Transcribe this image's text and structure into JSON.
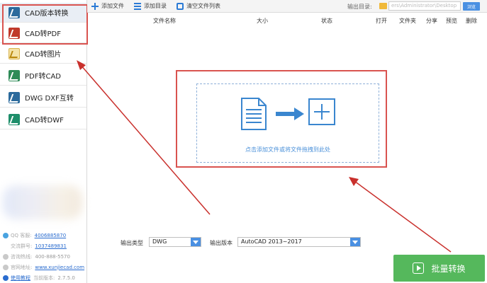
{
  "sidebar": {
    "items": [
      {
        "label": "CAD版本转换",
        "icon": "cad-file-icon"
      },
      {
        "label": "CAD转PDF",
        "icon": "pdf-file-icon"
      },
      {
        "label": "CAD转图片",
        "icon": "image-file-icon"
      },
      {
        "label": "PDF转CAD",
        "icon": "pdf-to-cad-icon"
      },
      {
        "label": "DWG DXF互转",
        "icon": "dwg-file-icon"
      },
      {
        "label": "CAD转DWF",
        "icon": "dwf-file-icon"
      }
    ],
    "info": {
      "qq_label": "QQ 客服:",
      "qq_value": "4006885870",
      "group_label": "交流群号:",
      "group_value": "1037489831",
      "phone_label": "咨询热线:",
      "phone_value": "400-888-5570",
      "site_label": "官网地址:",
      "site_value": "www.xunjiecad.com",
      "tutorial_label": "使用教程",
      "version_label": "当前版本:",
      "version_value": "2.7.5.0"
    }
  },
  "toolbar": {
    "add_file": "添加文件",
    "add_folder": "添加目录",
    "clear_list": "清空文件列表",
    "output_dir_label": "输出目录:",
    "output_dir_value": "ers\\Administrator\\Desktop",
    "browse": "浏览"
  },
  "columns": [
    "文件名称",
    "大小",
    "状态",
    "打开",
    "文件夹",
    "分享",
    "预览",
    "删除"
  ],
  "dropzone": {
    "hint": "点击添加文件或将文件拖拽到此处"
  },
  "options": {
    "output_type_label": "输出类型",
    "output_type_value": "DWG",
    "output_version_label": "输出版本",
    "output_version_value": "AutoCAD 2013~2017"
  },
  "convert_button": "批量转换",
  "colors": {
    "accent": "#4a90e2",
    "annotation_red": "#d9534f",
    "convert_green": "#55b85c"
  }
}
